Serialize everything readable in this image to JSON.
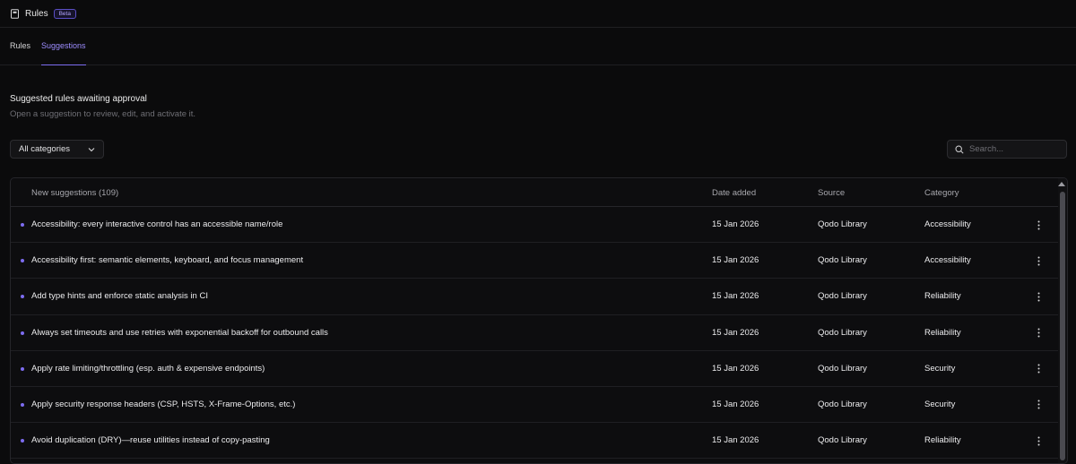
{
  "header": {
    "title": "Rules",
    "badge": "Beta",
    "icon": "book-icon"
  },
  "tabs": [
    {
      "label": "Rules",
      "active": false
    },
    {
      "label": "Suggestions",
      "active": true
    }
  ],
  "page": {
    "heading": "Suggested rules awaiting approval",
    "subheading": "Open a suggestion to review, edit, and activate it."
  },
  "filters": {
    "category_select": "All categories",
    "search_placeholder": "Search..."
  },
  "table": {
    "headers": {
      "name": "New suggestions (109)",
      "date": "Date added",
      "source": "Source",
      "category": "Category"
    },
    "rows": [
      {
        "name": "Accessibility: every interactive control has an accessible name/role",
        "date": "15 Jan 2026",
        "source": "Qodo Library",
        "category": "Accessibility"
      },
      {
        "name": "Accessibility first: semantic elements, keyboard, and focus management",
        "date": "15 Jan 2026",
        "source": "Qodo Library",
        "category": "Accessibility"
      },
      {
        "name": "Add type hints and enforce static analysis in CI",
        "date": "15 Jan 2026",
        "source": "Qodo Library",
        "category": "Reliability"
      },
      {
        "name": "Always set timeouts and use retries with exponential backoff for outbound calls",
        "date": "15 Jan 2026",
        "source": "Qodo Library",
        "category": "Reliability"
      },
      {
        "name": "Apply rate limiting/throttling (esp. auth & expensive endpoints)",
        "date": "15 Jan 2026",
        "source": "Qodo Library",
        "category": "Security"
      },
      {
        "name": "Apply security response headers (CSP, HSTS, X-Frame-Options, etc.)",
        "date": "15 Jan 2026",
        "source": "Qodo Library",
        "category": "Security"
      },
      {
        "name": "Avoid duplication (DRY)—reuse utilities instead of copy-pasting",
        "date": "15 Jan 2026",
        "source": "Qodo Library",
        "category": "Reliability"
      }
    ]
  },
  "colors": {
    "accent": "#7d6cf0",
    "background": "#0b0b0c"
  }
}
